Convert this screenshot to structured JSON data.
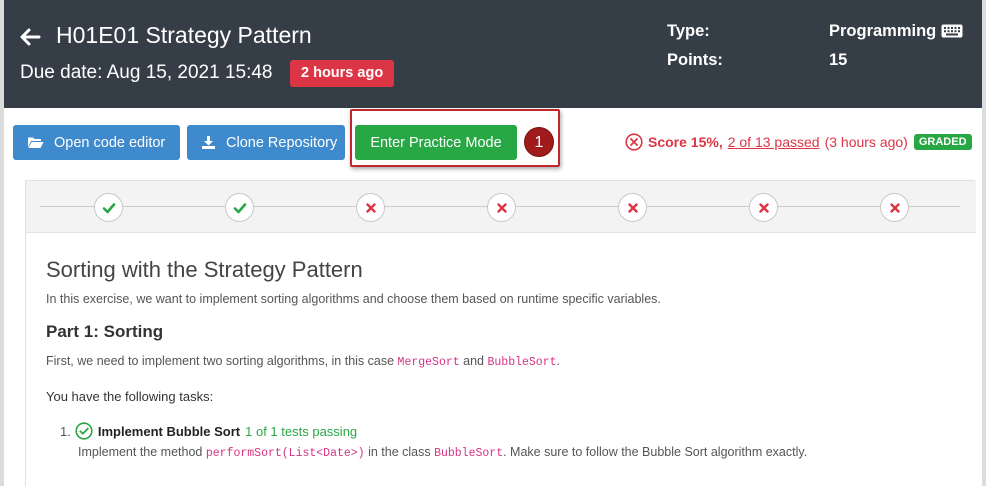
{
  "header": {
    "title": "H01E01 Strategy Pattern",
    "due_date": "Due date: Aug 15, 2021 15:48",
    "due_badge": "2 hours ago",
    "type_label": "Type:",
    "type_value": "Programming",
    "points_label": "Points:",
    "points_value": "15"
  },
  "toolbar": {
    "code_editor_label": "Open code editor",
    "clone_label": "Clone Repository",
    "practice_label": "Enter Practice Mode",
    "step_marker": "1"
  },
  "score": {
    "text": "Score 15%,",
    "link": "2 of 13 passed",
    "time": "(3 hours ago)",
    "badge": "GRADED"
  },
  "tests": [
    {
      "status": "passed"
    },
    {
      "status": "passed"
    },
    {
      "status": "failed"
    },
    {
      "status": "failed"
    },
    {
      "status": "failed"
    },
    {
      "status": "failed"
    },
    {
      "status": "failed"
    }
  ],
  "problem": {
    "title": "Sorting with the Strategy Pattern",
    "intro": "In this exercise, we want to implement sorting algorithms and choose them based on runtime specific variables.",
    "part1_heading": "Part 1: Sorting",
    "part1_p_before": "First, we need to implement two sorting algorithms, in this case ",
    "part1_code1": "MergeSort",
    "part1_p_and": " and ",
    "part1_code2": "BubbleSort",
    "part1_p_end": ".",
    "tasks_intro": "You have the following tasks:",
    "task1": {
      "number": "1.",
      "name": "Implement Bubble Sort",
      "status": "1 of 1 tests passing",
      "desc_before": "Implement the method ",
      "desc_code1": "performSort(List<Date>)",
      "desc_mid": " in the class ",
      "desc_code2": "BubbleSort",
      "desc_end": ". Make sure to follow the Bubble Sort algorithm exactly."
    }
  },
  "colors": {
    "header_bg": "#353d47",
    "primary": "#3e8acc",
    "success": "#28a745",
    "danger": "#dc3545",
    "highlight": "#c0272d"
  }
}
